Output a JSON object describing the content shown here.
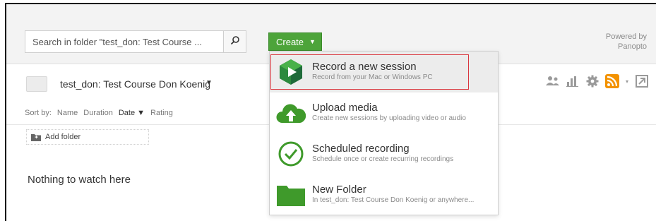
{
  "search": {
    "placeholder": "Search in folder \"test_don: Test Course ..."
  },
  "create": {
    "label": "Create",
    "caret": "▼"
  },
  "powered_by": {
    "line1": "Powered by",
    "line2": "Panopto"
  },
  "folder": {
    "title": "test_don: Test Course Don Koenig",
    "caret": "▼"
  },
  "sort": {
    "label": "Sort by:",
    "options": [
      "Name",
      "Duration",
      "Date ▼",
      "Rating"
    ]
  },
  "add_folder": {
    "label": "Add folder"
  },
  "empty_message": "Nothing to watch here",
  "menu": {
    "items": [
      {
        "title": "Record a new session",
        "subtitle": "Record from your Mac or Windows PC"
      },
      {
        "title": "Upload media",
        "subtitle": "Create new sessions by uploading video or audio"
      },
      {
        "title": "Scheduled recording",
        "subtitle": "Schedule once or create recurring recordings"
      },
      {
        "title": "New Folder",
        "subtitle": "In test_don: Test Course Don Koenig or anywhere..."
      }
    ]
  },
  "colors": {
    "create_green": "#4da43a",
    "accent_green": "#3f9a2b",
    "rss_orange": "#f39200",
    "highlight_red": "#d9363e"
  },
  "icons": [
    "search-icon",
    "people-icon",
    "stats-icon",
    "gear-icon",
    "rss-icon",
    "open-external-icon",
    "add-folder-icon",
    "panopto-logo-icon",
    "cloud-upload-icon",
    "clock-check-icon",
    "folder-icon"
  ]
}
